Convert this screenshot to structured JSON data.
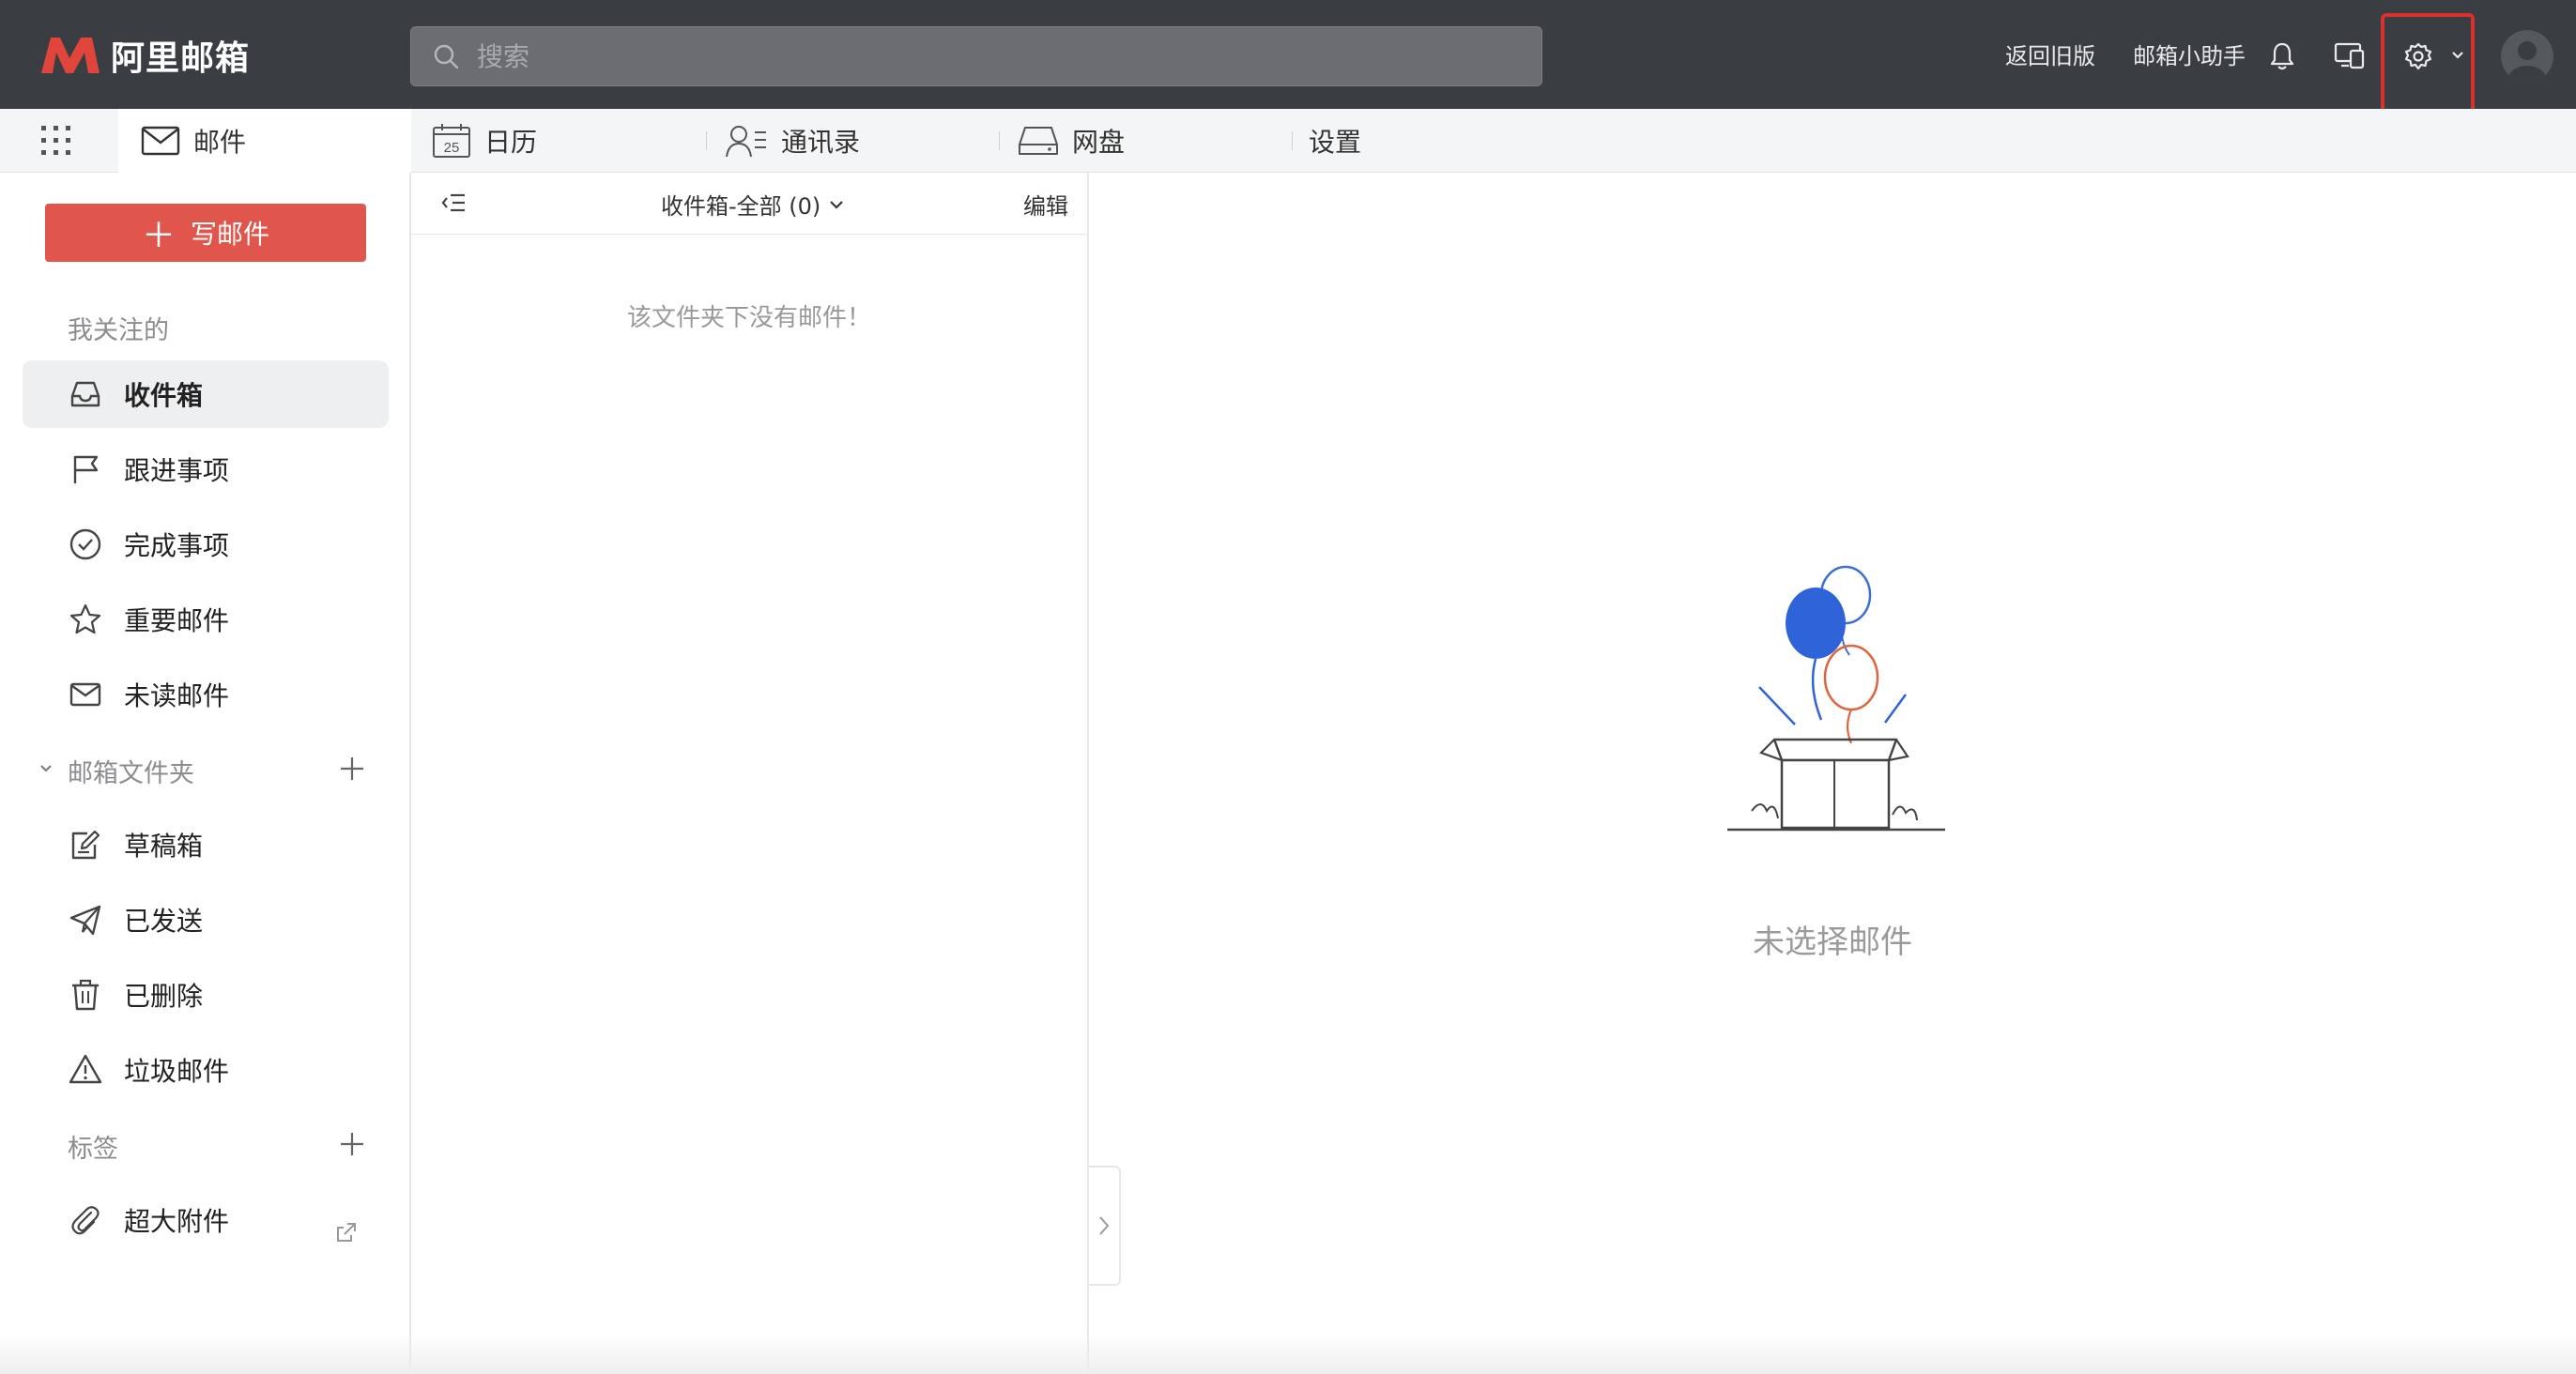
{
  "header": {
    "logo_text": "阿里邮箱",
    "search_placeholder": "搜索",
    "links": {
      "old_version": "返回旧版",
      "assistant": "邮箱小助手"
    },
    "icons": [
      "bell-icon",
      "devices-icon",
      "gear-icon",
      "chevron-down-icon",
      "avatar-icon"
    ],
    "highlight_color": "#d9322e"
  },
  "tabs": [
    {
      "label": "邮件",
      "icon": "mail-icon",
      "active": true
    },
    {
      "label": "日历",
      "icon": "calendar-icon",
      "badge": "25"
    },
    {
      "label": "通讯录",
      "icon": "contacts-icon"
    },
    {
      "label": "网盘",
      "icon": "drive-icon"
    },
    {
      "label": "设置"
    }
  ],
  "sidebar": {
    "compose_label": "写邮件",
    "compose_color": "#e0564d",
    "favorites_header": "我关注的",
    "favorites": [
      {
        "label": "收件箱",
        "icon": "inbox-icon",
        "active": true
      },
      {
        "label": "跟进事项",
        "icon": "flag-icon"
      },
      {
        "label": "完成事项",
        "icon": "check-circle-icon"
      },
      {
        "label": "重要邮件",
        "icon": "star-icon"
      },
      {
        "label": "未读邮件",
        "icon": "envelope-icon"
      }
    ],
    "folders_header": "邮箱文件夹",
    "folders": [
      {
        "label": "草稿箱",
        "icon": "draft-icon"
      },
      {
        "label": "已发送",
        "icon": "send-icon"
      },
      {
        "label": "已删除",
        "icon": "trash-icon"
      },
      {
        "label": "垃圾邮件",
        "icon": "warning-icon"
      }
    ],
    "tags_header": "标签",
    "attachments_label": "超大附件"
  },
  "mail_list": {
    "folder_title": "收件箱-全部 (0)",
    "edit_label": "编辑",
    "empty_message": "该文件夹下没有邮件！"
  },
  "reader": {
    "no_selection_text": "未选择邮件"
  }
}
